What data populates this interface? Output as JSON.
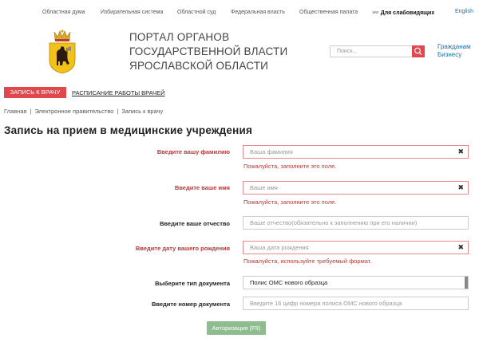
{
  "topbar": {
    "links": [
      "Областная дума",
      "Избирательная система",
      "Областной суд",
      "Федеральная власть",
      "Общественная палата"
    ],
    "vision_label": "Для слабовидящих",
    "lang_label": "English"
  },
  "header": {
    "title_line1": "Портал органов",
    "title_line2": "государственной власти",
    "title_line3": "Ярославской области",
    "search_placeholder": "Поиск...",
    "audience_citizens": "Гражданам",
    "audience_business": "Бизнесу"
  },
  "tabs": {
    "active": "ЗАПИСЬ К ВРАЧУ",
    "second": "РАСПИСАНИЕ РАБОТЫ ВРАЧЕЙ"
  },
  "breadcrumb": {
    "home": "Главная",
    "egov": "Электронное правительство",
    "current": "Запись к врачу",
    "separator": "|"
  },
  "page": {
    "title": "Запись на прием в медицинские учреждения"
  },
  "form": {
    "surname_label": "Введите вашу фамилию",
    "surname_placeholder": "Ваша фамилия",
    "surname_error": "Пожалуйста, заполните это поле.",
    "name_label": "Введите ваше имя",
    "name_placeholder": "Ваше имя",
    "name_error": "Пожалуйста, заполните это поле.",
    "patronymic_label": "Введите ваше отчество",
    "patronymic_placeholder": "Ваше отчество(обязательно к заполнению при его наличии)",
    "birthdate_label": "Введите дату вашего рождения",
    "birthdate_placeholder": "Ваша дата рождения",
    "birthdate_error": "Пожалуйста, используйте требуемый формат.",
    "doctype_label": "Выберите тип документа",
    "doctype_value": "Полис ОМС нового образца",
    "docnum_label": "Введите номер документа",
    "docnum_placeholder": "Введите 16 цифр номера полиса ОМС нового образца",
    "submit_label": "Авторизация (F9)",
    "clear_glyph": "✖"
  },
  "colors": {
    "accent_red": "#e0484d",
    "error_text": "#b23a3a",
    "link_blue": "#1a6fae",
    "submit_green": "#8fbc8f"
  }
}
